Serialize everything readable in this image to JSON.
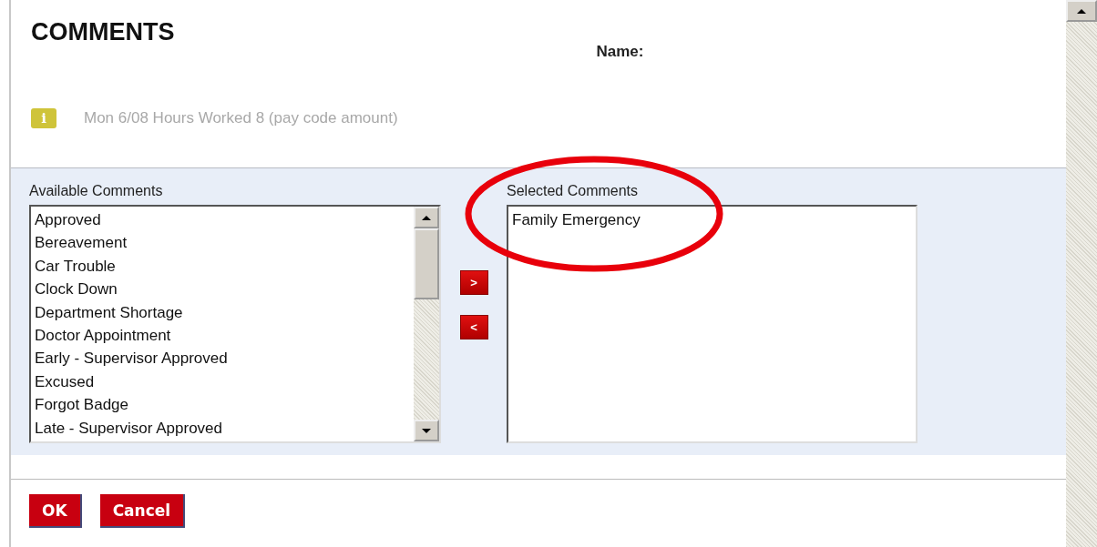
{
  "title": "COMMENTS",
  "name_label": "Name:",
  "info": {
    "text": "Mon 6/08  Hours Worked 8  (pay code amount)",
    "icon": "i"
  },
  "available": {
    "label": "Available Comments",
    "items": [
      {
        "label": "Approved"
      },
      {
        "label": "Bereavement"
      },
      {
        "label": "Car Trouble"
      },
      {
        "label": "Clock Down"
      },
      {
        "label": "Department Shortage"
      },
      {
        "label": "Doctor Appointment"
      },
      {
        "label": "Early - Supervisor Approved"
      },
      {
        "label": "Excused"
      },
      {
        "label": "Forgot Badge"
      },
      {
        "label": "Late - Supervisor Approved"
      }
    ]
  },
  "move_buttons": [
    {
      "label": ">"
    },
    {
      "label": "<"
    }
  ],
  "selected": {
    "label": "Selected Comments",
    "items": [
      {
        "label": "Family Emergency"
      }
    ]
  },
  "buttons": [
    {
      "label": "OK"
    },
    {
      "label": "Cancel"
    }
  ]
}
